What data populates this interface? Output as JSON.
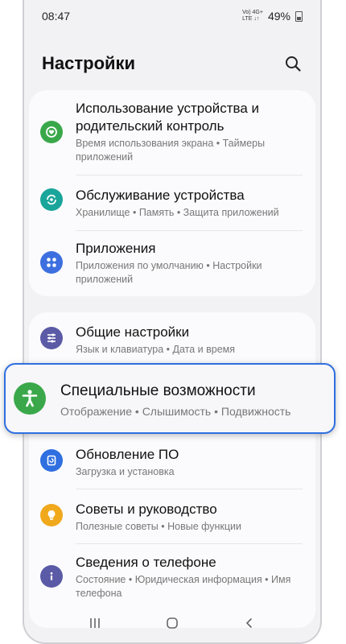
{
  "status": {
    "time": "08:47",
    "network_top": "Vo) 4G+",
    "network_bottom": "LTE ↓↑",
    "battery": "49%"
  },
  "header": {
    "title": "Настройки"
  },
  "card1": {
    "items": [
      {
        "title": "Использование устройства и родительский контроль",
        "subtitle": "Время использования экрана • Таймеры приложений",
        "icon": "digital-wellbeing-icon",
        "color": "#3aa84a"
      },
      {
        "title": "Обслуживание устройства",
        "subtitle": "Хранилище • Память • Защита приложений",
        "icon": "device-care-icon",
        "color": "#1aa59a"
      },
      {
        "title": "Приложения",
        "subtitle": "Приложения по умолчанию • Настройки приложений",
        "icon": "apps-icon",
        "color": "#3d6fe0"
      }
    ]
  },
  "card2": {
    "items": [
      {
        "title": "Общие настройки",
        "subtitle": "Язык и клавиатура • Дата и время",
        "icon": "sliders-icon",
        "color": "#5a5aa6"
      },
      {
        "title": "Обновление ПО",
        "subtitle": "Загрузка и установка",
        "icon": "software-update-icon",
        "color": "#2f6fe0"
      },
      {
        "title": "Советы и руководство",
        "subtitle": "Полезные советы • Новые функции",
        "icon": "lightbulb-icon",
        "color": "#f0a81c"
      },
      {
        "title": "Сведения о телефоне",
        "subtitle": "Состояние • Юридическая информация • Имя телефона",
        "icon": "info-icon",
        "color": "#5a5aa6"
      }
    ]
  },
  "highlight": {
    "title": "Специальные возможности",
    "subtitle": "Отображение • Слышимость • Подвижность",
    "icon": "accessibility-icon",
    "color": "#3aa84a"
  },
  "accent": "#2f6fe0"
}
